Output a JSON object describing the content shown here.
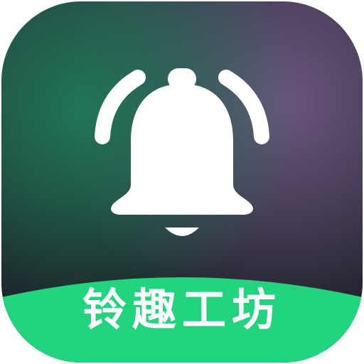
{
  "app": {
    "name": "铃趣工坊",
    "icon": "bell-icon",
    "colors": {
      "banner": "#22d47e",
      "glyph": "#ffffff",
      "background_dark": "#1e2029",
      "glow_green": "#1f7a58",
      "glow_purple": "#6e5882"
    }
  }
}
